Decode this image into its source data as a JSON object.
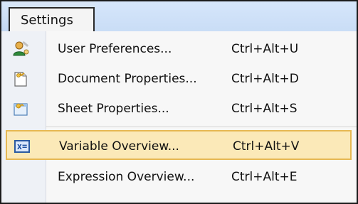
{
  "menu": {
    "title": "Settings"
  },
  "items": [
    {
      "label": "User Preferences...",
      "shortcut": "Ctrl+Alt+U",
      "icon": "user-preferences-icon"
    },
    {
      "label": "Document Properties...",
      "shortcut": "Ctrl+Alt+D",
      "icon": "document-properties-icon"
    },
    {
      "label": "Sheet Properties...",
      "shortcut": "Ctrl+Alt+S",
      "icon": "sheet-properties-icon"
    },
    {
      "label": "Variable Overview...",
      "shortcut": "Ctrl+Alt+V",
      "icon": "variable-overview-icon",
      "highlighted": true,
      "badge": "x="
    },
    {
      "label": "Expression Overview...",
      "shortcut": "Ctrl+Alt+E",
      "icon": ""
    }
  ],
  "colors": {
    "highlight_bg": "#fbe9b8",
    "highlight_border": "#e6b853",
    "menubar": "#c9ddf6"
  }
}
